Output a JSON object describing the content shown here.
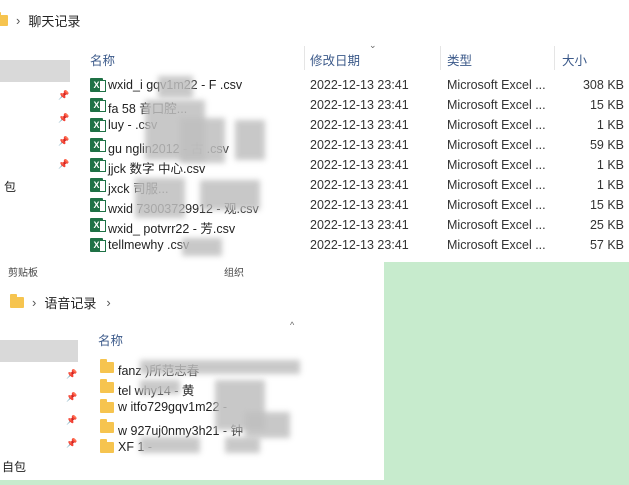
{
  "window1": {
    "breadcrumb": "聊天记录",
    "nav_bottom_label": "包",
    "columns": {
      "name": "名称",
      "date": "修改日期",
      "type": "类型",
      "size": "大小"
    },
    "files": [
      {
        "name": "wxid_i          gqv1m22 - F     .csv",
        "date": "2022-12-13 23:41",
        "type": "Microsoft Excel ...",
        "size": "308 KB"
      },
      {
        "name": "fa        58       音口腔...",
        "date": "2022-12-13 23:41",
        "type": "Microsoft Excel ...",
        "size": "15 KB"
      },
      {
        "name": "luy              -      .csv",
        "date": "2022-12-13 23:41",
        "type": "Microsoft Excel ...",
        "size": "1 KB"
      },
      {
        "name": "gu    nglin2012 - 古    .csv",
        "date": "2022-12-13 23:41",
        "type": "Microsoft Excel ...",
        "size": "59 KB"
      },
      {
        "name": "jjck             数字    中心.csv",
        "date": "2022-12-13 23:41",
        "type": "Microsoft Excel ...",
        "size": "1 KB"
      },
      {
        "name": "jxck                     司服...",
        "date": "2022-12-13 23:41",
        "type": "Microsoft Excel ...",
        "size": "1 KB"
      },
      {
        "name": "wxid     73003729912 -      观.csv",
        "date": "2022-12-13 23:41",
        "type": "Microsoft Excel ...",
        "size": "15 KB"
      },
      {
        "name": "wxid_    potvrr22 -   芳.csv",
        "date": "2022-12-13 23:41",
        "type": "Microsoft Excel ...",
        "size": "25 KB"
      },
      {
        "name": "tellmewhy                .csv",
        "date": "2022-12-13 23:41",
        "type": "Microsoft Excel ...",
        "size": "57 KB"
      }
    ]
  },
  "statusbar": {
    "left": "剪贴板",
    "right": "组织"
  },
  "window2": {
    "breadcrumb": "语音记录",
    "nav_bottom_label": "自包",
    "columns": {
      "name": "名称"
    },
    "folders": [
      {
        "name": "fanz                     )所范志春"
      },
      {
        "name": "tel     why14 - 黄"
      },
      {
        "name": "w     itfo729gqv1m22 -"
      },
      {
        "name": "w     927uj0nmy3h21 - 钟"
      },
      {
        "name": "XF              1 -"
      }
    ]
  }
}
